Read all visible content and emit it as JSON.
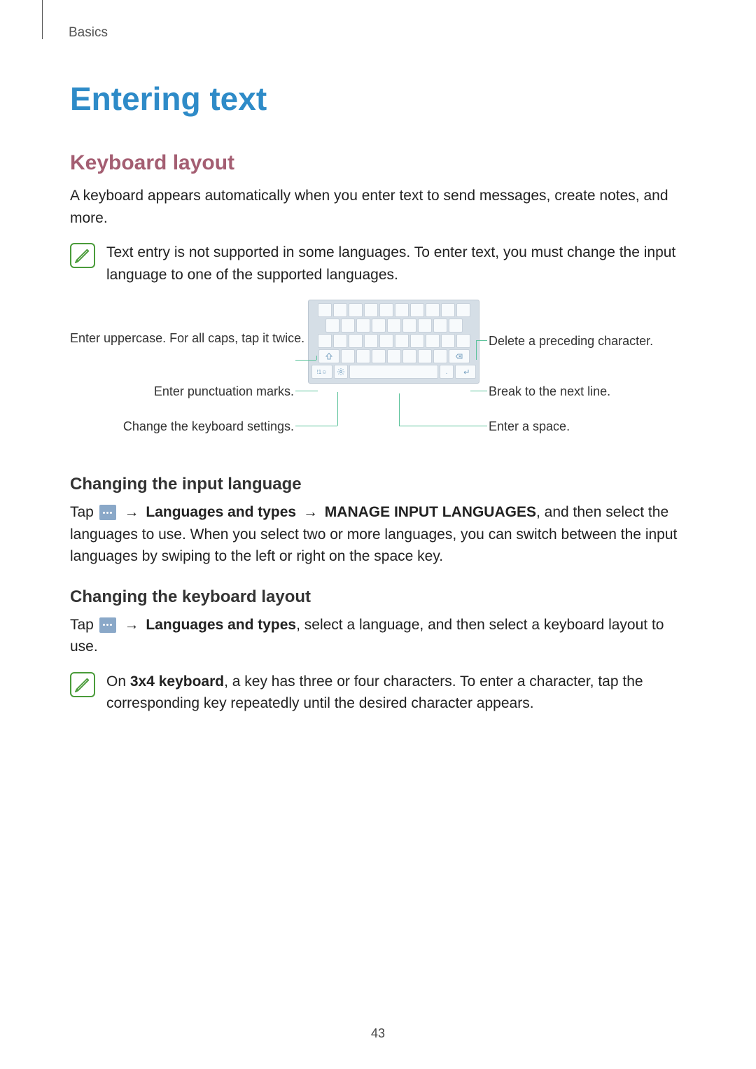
{
  "header": {
    "section": "Basics"
  },
  "title": "Entering text",
  "keyboard_layout": {
    "heading": "Keyboard layout",
    "intro": "A keyboard appears automatically when you enter text to send messages, create notes, and more.",
    "note": "Text entry is not supported in some languages. To enter text, you must change the input language to one of the supported languages."
  },
  "diagram": {
    "callouts": {
      "uppercase": "Enter uppercase. For all caps, tap it twice.",
      "punctuation": "Enter punctuation marks.",
      "settings": "Change the keyboard settings.",
      "delete": "Delete a preceding character.",
      "nextline": "Break to the next line.",
      "space": "Enter a space."
    }
  },
  "change_lang": {
    "heading": "Changing the input language",
    "prefix": "Tap ",
    "arrow": "→",
    "step1_bold": " Languages and types ",
    "step2_bold": " MANAGE INPUT LANGUAGES",
    "suffix": ", and then select the languages to use. When you select two or more languages, you can switch between the input languages by swiping to the left or right on the space key."
  },
  "change_layout": {
    "heading": "Changing the keyboard layout",
    "prefix": "Tap ",
    "arrow": "→",
    "step1_bold": " Languages and types",
    "suffix": ", select a language, and then select a keyboard layout to use.",
    "note_prefix": "On ",
    "note_bold": "3x4 keyboard",
    "note_suffix": ", a key has three or four characters. To enter a character, tap the corresponding key repeatedly until the desired character appears."
  },
  "page_number": "43"
}
